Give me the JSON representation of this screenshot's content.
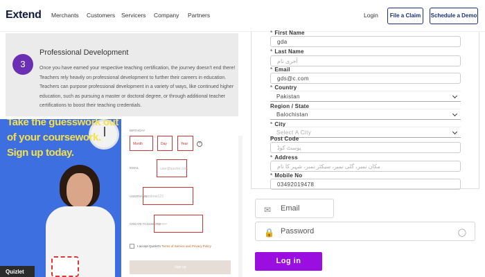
{
  "nav": {
    "logo": "Extend",
    "links": [
      "Merchants",
      "Customers",
      "Servicers",
      "Company",
      "Partners"
    ],
    "login": "Login",
    "file_claim": "File a Claim",
    "schedule_demo": "Schedule a Demo"
  },
  "pd": {
    "number": "3",
    "title": "Professional Development",
    "text": "Once you have earned your respective teaching certification, the journey doesn't end there! Teachers rely heavily on professional development to further their careers in education. Teachers can purpose professional development in a variety of ways, like continued higher education, such as pursuing a master or doctoral degree, or through additional teacher certifications to boost their teaching credentials."
  },
  "ad": {
    "line1": "Take the guesswork out",
    "line2": "of your coursework.",
    "line3": "Sign up today.",
    "brand": "Quizlet"
  },
  "signup": {
    "birthday_label": "BIRTHDAY",
    "month": "Month",
    "day": "Day",
    "year": "Year",
    "email_label": "EMAIL",
    "email_placeholder": "user@quizlet.com",
    "username_label": "USERNAME",
    "username_placeholder": "andrew123",
    "password_label": "CREATE PASSWORD",
    "password_placeholder": "••••••••",
    "terms_prefix": "I accept Quizlet's",
    "terms_link": "Terms of Service and Privacy Policy",
    "button": "Sign up"
  },
  "reg": {
    "first_name_label": "First Name",
    "first_name": "gda",
    "last_name_label": "Last Name",
    "last_name": "آخری نام",
    "email_label": "Email",
    "email": "gds@c.com",
    "country_label": "Country",
    "country": "Pakistan",
    "region_label": "Region / State",
    "region": "Balochistan",
    "city_label": "City",
    "city": "Select A City",
    "postcode_label": "Post Code",
    "postcode": "پوسٹ کوڈ",
    "address_label": "Address",
    "address": "مکان نمبر، گلی نمبر، سیکٹر نمبر، شہر کا نام",
    "mobile_label": "Mobile No",
    "mobile": "03492019478"
  },
  "login": {
    "email_placeholder": "Email",
    "password_placeholder": "Password",
    "button": "Log in"
  }
}
